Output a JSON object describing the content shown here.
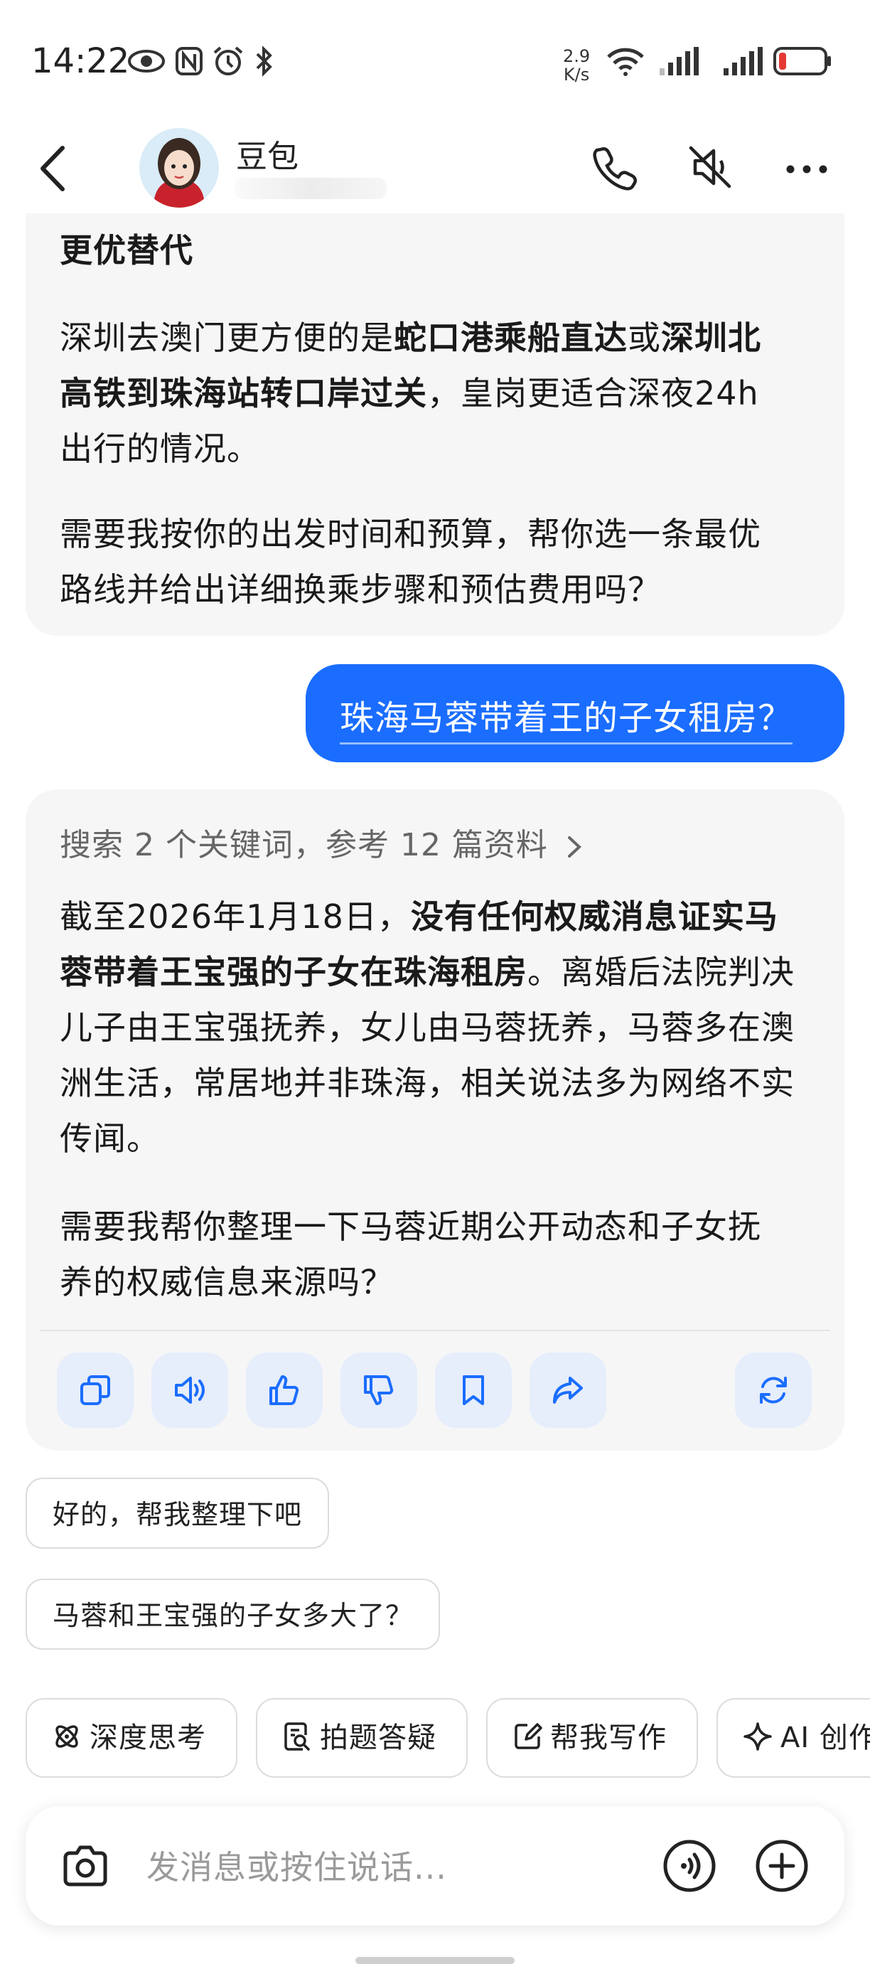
{
  "status_bar": {
    "time": "14:22",
    "net_speed_value": "2.9",
    "net_speed_unit": "K/s",
    "icons": [
      "eye-icon",
      "nfc-icon",
      "alarm-icon",
      "bluetooth-icon",
      "wifi-icon",
      "signal-icon",
      "signal-icon",
      "battery-icon"
    ],
    "battery_level": 0.12
  },
  "header": {
    "bot_name": "豆包",
    "icons": [
      "back-icon",
      "phone-icon",
      "mute-icon",
      "more-icon"
    ]
  },
  "conversation": {
    "prev_answer": {
      "heading": "更优替代",
      "p1_a": "深圳去澳门更方便的是",
      "p1_b": "蛇口港乘船直达",
      "p1_c": "或",
      "p1_d": "深圳北高铁到珠海站转口岸过关",
      "p1_e": "，皇岗更适合深夜24h出行的情况。",
      "p2": "需要我按你的出发时间和预算，帮你选一条最优路线并给出详细换乘步骤和预估费用吗？"
    },
    "user_message": "珠海马蓉带着王的子女租房？",
    "answer": {
      "search_summary": "搜索 2 个关键词，参考 12 篇资料",
      "p1_a": "截至2026年1月18日，",
      "p1_b": "没有任何权威消息证实马蓉带着王宝强的子女在珠海租房",
      "p1_c": "。离婚后法院判决儿子由王宝强抚养，女儿由马蓉抚养，马蓉多在澳洲生活，常居地并非珠海，相关说法多为网络不实传闻。",
      "p2": "需要我帮你整理一下马蓉近期公开动态和子女抚养的权威信息来源吗？",
      "actions": [
        "copy-icon",
        "speaker-icon",
        "thumbs-up-icon",
        "thumbs-down-icon",
        "bookmark-icon",
        "share-icon",
        "regenerate-icon"
      ]
    }
  },
  "suggestions": [
    "好的，帮我整理下吧",
    "马蓉和王宝强的子女多大了？"
  ],
  "skills": [
    {
      "label": "深度思考",
      "icon": "atom-icon"
    },
    {
      "label": "拍题答疑",
      "icon": "scan-question-icon"
    },
    {
      "label": "帮我写作",
      "icon": "edit-icon"
    },
    {
      "label": "AI 创作",
      "icon": "sparkle-icon"
    }
  ],
  "input": {
    "placeholder": "发消息或按住说话...",
    "icons": [
      "camera-icon",
      "voice-icon",
      "plus-icon"
    ]
  },
  "colors": {
    "accent": "#1a6dff",
    "bubble": "#f6f6f7",
    "action_bg": "#e6edfb",
    "action_icon": "#1a6dff"
  }
}
